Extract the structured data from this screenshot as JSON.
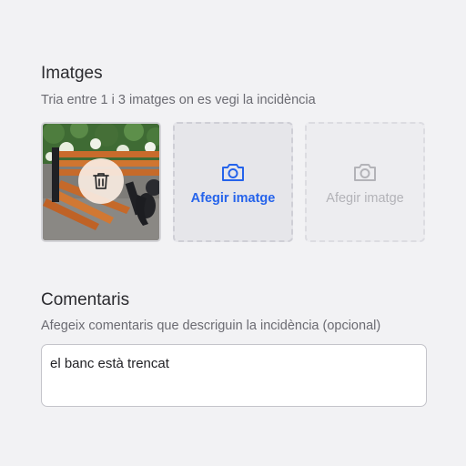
{
  "images_section": {
    "title": "Imatges",
    "subtitle": "Tria entre 1 i 3 imatges on es vegi la incidència",
    "tiles": [
      {
        "kind": "photo",
        "icon": "trash-icon"
      },
      {
        "kind": "add",
        "label": "Afegir imatge",
        "icon": "camera-icon",
        "enabled": true
      },
      {
        "kind": "add",
        "label": "Afegir imatge",
        "icon": "camera-icon",
        "enabled": false
      }
    ]
  },
  "comments_section": {
    "title": "Comentaris",
    "subtitle": "Afegeix comentaris que descriguin la incidència (opcional)",
    "value": "el banc està trencat"
  },
  "colors": {
    "accent": "#2563eb",
    "disabled": "#b3b3b8",
    "background": "#f2f2f4"
  }
}
